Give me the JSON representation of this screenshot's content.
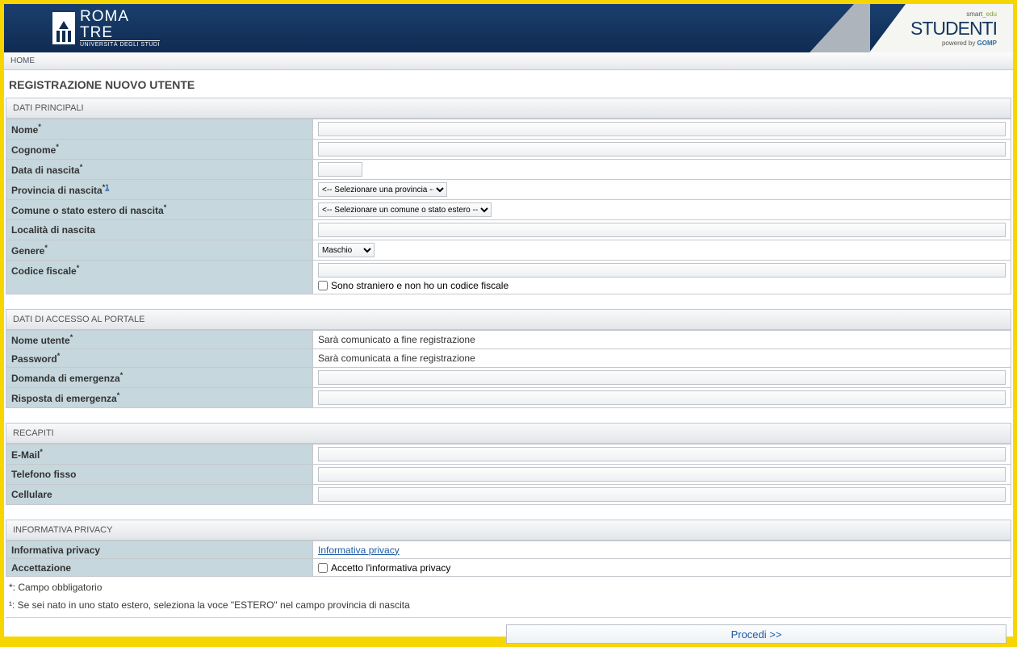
{
  "header": {
    "logo_top": "ROMA",
    "logo_bottom": "TRE",
    "logo_sub": "UNIVERSITÀ DEGLI STUDI",
    "smartedu_a": "smart",
    "smartedu_b": "_edu",
    "studenti": "STUDENTI",
    "gomp_prefix": "powered by",
    "gomp": "GOMP"
  },
  "nav": {
    "home": "HOME"
  },
  "page_title": "REGISTRAZIONE NUOVO UTENTE",
  "sections": {
    "dati_principali": "DATI PRINCIPALI",
    "dati_accesso": "DATI DI ACCESSO AL PORTALE",
    "recapiti": "RECAPITI",
    "privacy": "INFORMATIVA PRIVACY"
  },
  "fields": {
    "nome": "Nome",
    "cognome": "Cognome",
    "data_nascita": "Data di nascita",
    "provincia": "Provincia di nascita",
    "comune": "Comune o stato estero di nascita",
    "localita": "Località di nascita",
    "genere": "Genere",
    "codice_fiscale": "Codice fiscale",
    "nome_utente": "Nome utente",
    "password": "Password",
    "domanda": "Domanda di emergenza",
    "risposta": "Risposta di emergenza",
    "email": "E-Mail",
    "telefono": "Telefono fisso",
    "cellulare": "Cellulare",
    "info_privacy_label": "Informativa privacy",
    "accettazione": "Accettazione"
  },
  "selects": {
    "provincia_placeholder": "<-- Selezionare una provincia -->",
    "comune_placeholder": "<-- Selezionare un comune o stato estero -->",
    "genere_value": "Maschio"
  },
  "static": {
    "straniero_cb": "Sono straniero e non ho un codice fiscale",
    "nome_utente_msg": "Sarà comunicato a fine registrazione",
    "password_msg": "Sarà comunicata a fine registrazione",
    "privacy_link": "Informativa privacy",
    "accetto_cb": "Accetto l'informativa privacy"
  },
  "notes": {
    "req": "*: Campo obbligatorio",
    "estero": "¹: Se sei nato in uno stato estero, seleziona la voce \"ESTERO\" nel campo provincia di nascita"
  },
  "asterisk": "*",
  "note1": "1",
  "proceed": "Procedi >>"
}
